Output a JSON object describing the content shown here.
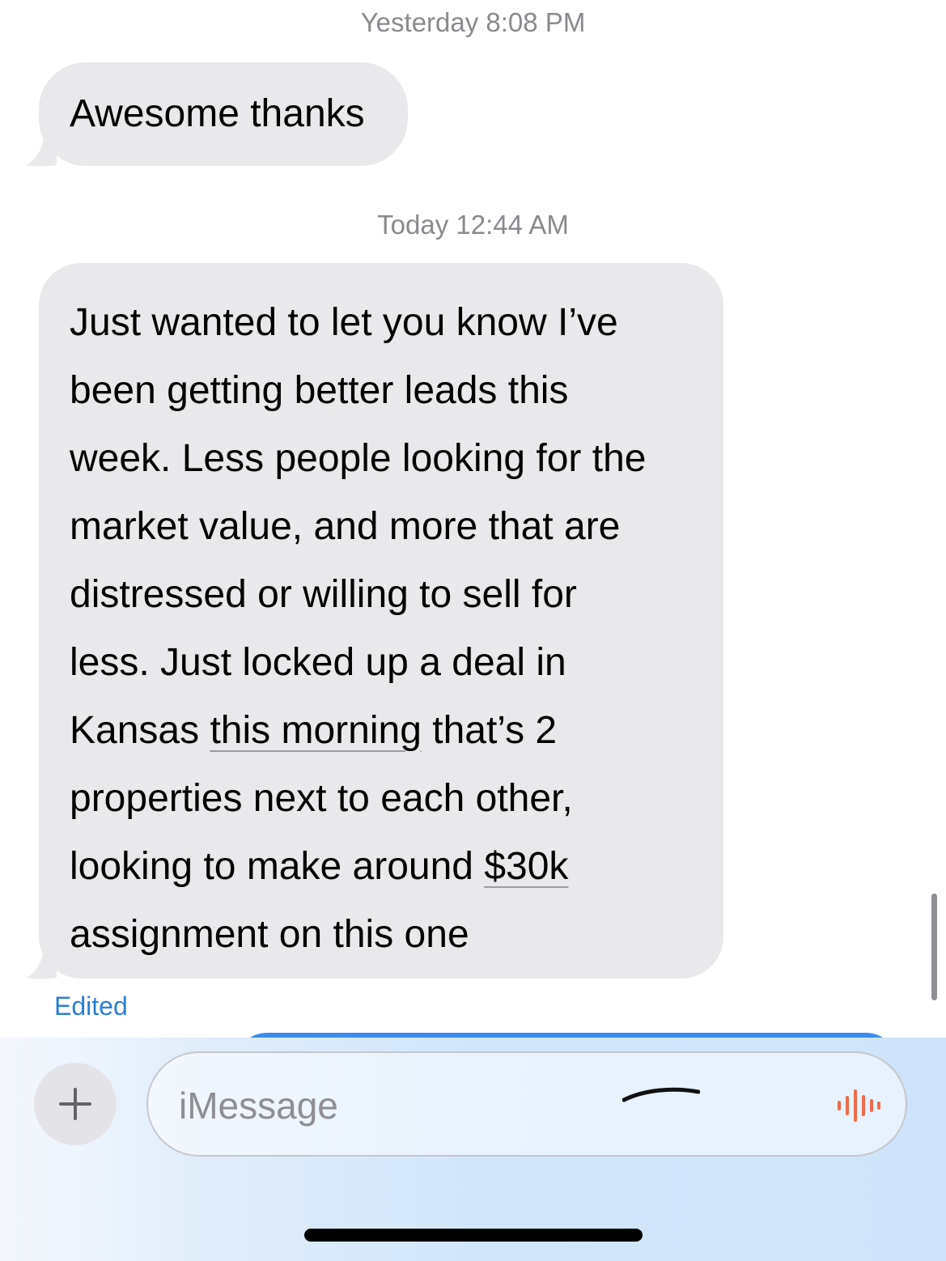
{
  "conversation": {
    "messages": [
      {
        "timestamp": "Yesterday 8:08 PM",
        "text": "Awesome thanks"
      },
      {
        "timestamp": "Today 12:44 AM",
        "lines": [
          {
            "pre": "Just wanted to let you know I’ve"
          },
          {
            "pre": "been getting better leads this"
          },
          {
            "pre": "week. Less people looking for the"
          },
          {
            "pre": "market value, and more that are"
          },
          {
            "pre": "distressed or willing to sell for"
          },
          {
            "pre": "less. Just locked up a deal in"
          },
          {
            "pre": "Kansas ",
            "link": "this morning",
            "post": " that’s 2"
          },
          {
            "pre": "properties next to each other,"
          },
          {
            "pre": "looking to make around ",
            "link": "$30k"
          },
          {
            "pre": "assignment on this one"
          }
        ],
        "status": "Edited"
      }
    ]
  },
  "composer": {
    "placeholder": "iMessage",
    "plus_icon": "plus-icon",
    "audio_icon": "audio-waveform-icon",
    "audio_color": "#ef6a4a"
  },
  "colors": {
    "received_bubble": "#e9e9eb",
    "edited_label": "#2a7fd4",
    "timestamp": "#8a8a8e"
  }
}
